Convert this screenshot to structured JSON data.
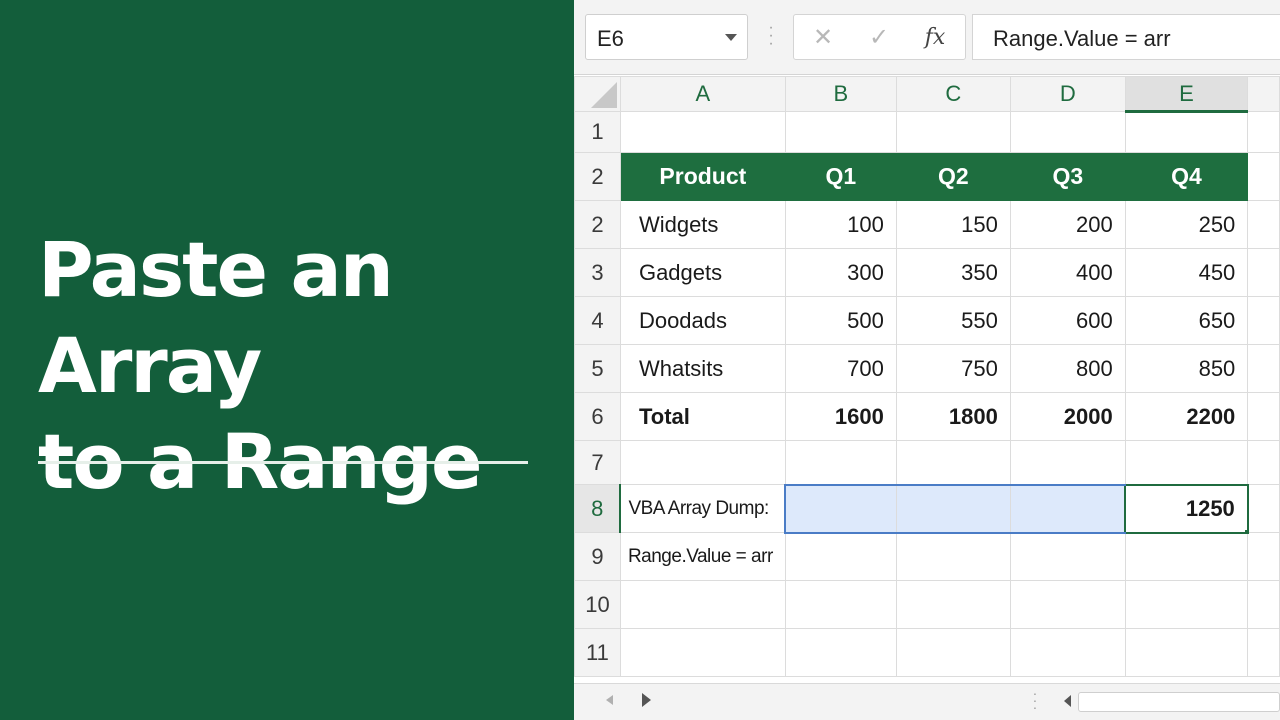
{
  "banner": {
    "title_line1": "Paste an Array",
    "title_line2": "to a Range",
    "background": "#135e3b"
  },
  "formula_bar": {
    "name_box": "E6",
    "formula": "Range.Value = arr",
    "buttons": {
      "cancel": "✕",
      "enter": "✓",
      "function": "fx"
    }
  },
  "grid": {
    "columns": [
      "A",
      "B",
      "C",
      "D",
      "E"
    ],
    "selected_column": "E",
    "rows": [
      {
        "header": "1",
        "cells": [
          "",
          "",
          "",
          "",
          ""
        ]
      },
      {
        "header": "2",
        "cells": [
          "Product",
          "Q1",
          "Q2",
          "Q3",
          "Q4"
        ]
      },
      {
        "header": "2",
        "cells": [
          "Widgets",
          "100",
          "150",
          "200",
          "250"
        ]
      },
      {
        "header": "3",
        "cells": [
          "Gadgets",
          "300",
          "350",
          "400",
          "450"
        ]
      },
      {
        "header": "4",
        "cells": [
          "Doodads",
          "500",
          "550",
          "600",
          "650"
        ]
      },
      {
        "header": "5",
        "cells": [
          "Whatsits",
          "700",
          "750",
          "800",
          "850"
        ]
      },
      {
        "header": "6",
        "cells": [
          "Total",
          "1600",
          "1800",
          "2000",
          "2200"
        ]
      },
      {
        "header": "7",
        "cells": [
          "",
          "",
          "",
          "",
          ""
        ]
      },
      {
        "header": "8",
        "cells": [
          "VBA Array Dump:",
          "",
          "",
          "",
          "1250"
        ]
      },
      {
        "header": "9",
        "cells": [
          "Range.Value = arr",
          "",
          "",
          "",
          ""
        ]
      },
      {
        "header": "10",
        "cells": [
          "",
          "",
          "",
          "",
          ""
        ]
      },
      {
        "header": "11",
        "cells": [
          "",
          "",
          "",
          "",
          ""
        ]
      }
    ]
  },
  "colors": {
    "header_fill": "#1e6e3f",
    "accent": "#1f6b3f",
    "selection_fill": "#dde9fb",
    "selection_border": "#4a7cc6"
  }
}
